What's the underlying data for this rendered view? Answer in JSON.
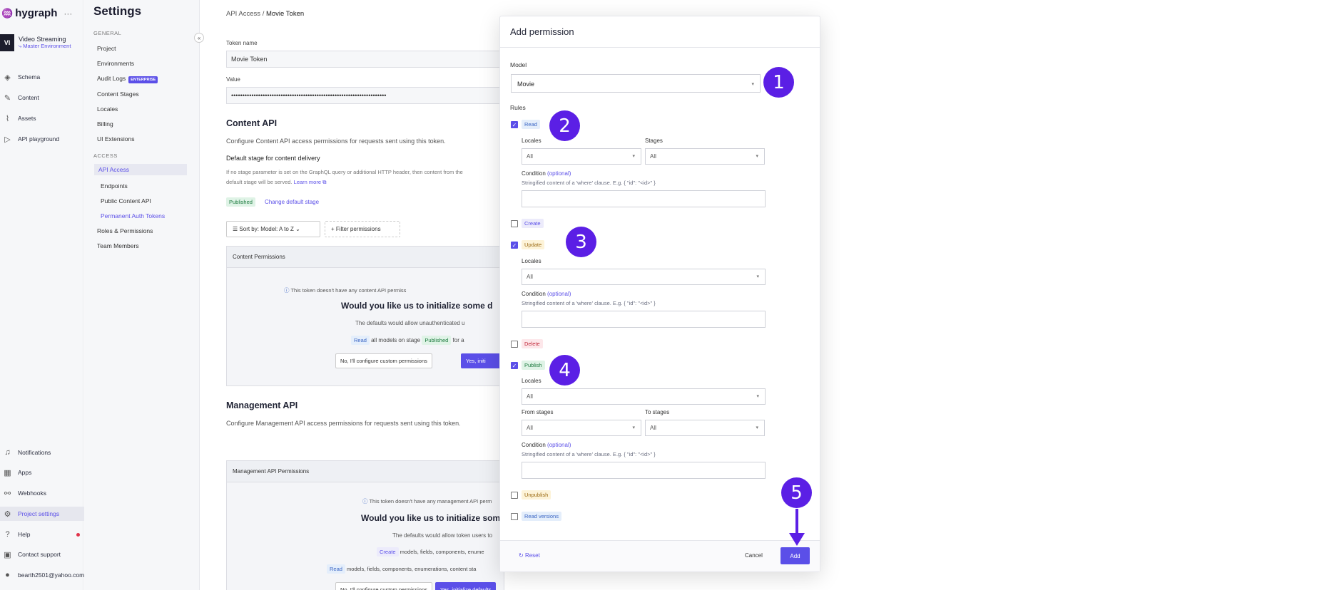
{
  "nav": {
    "logo": "hygraph",
    "logo_more": "···",
    "project_initials": "VI",
    "project_name": "Video Streaming",
    "environment": "Master Environment",
    "items": [
      {
        "label": "Schema",
        "icon": "schema-icon"
      },
      {
        "label": "Content",
        "icon": "content-icon"
      },
      {
        "label": "Assets",
        "icon": "assets-icon"
      },
      {
        "label": "API playground",
        "icon": "play-icon"
      }
    ],
    "bottom": [
      {
        "label": "Notifications",
        "icon": "bell-icon"
      },
      {
        "label": "Apps",
        "icon": "apps-icon"
      },
      {
        "label": "Webhooks",
        "icon": "webhooks-icon"
      },
      {
        "label": "Project settings",
        "icon": "gear-icon"
      },
      {
        "label": "Help",
        "icon": "help-icon"
      },
      {
        "label": "Contact support",
        "icon": "chat-icon"
      },
      {
        "label": "bearth2501@yahoo.com",
        "icon": "user-avatar"
      }
    ]
  },
  "settings": {
    "title": "Settings",
    "general_label": "GENERAL",
    "general": [
      "Project",
      "Environments",
      "Audit Logs",
      "Content Stages",
      "Locales",
      "Billing",
      "UI Extensions"
    ],
    "enterprise_badge": "ENTERPRISE",
    "access_label": "ACCESS",
    "access": [
      "API Access",
      "Endpoints",
      "Public Content API",
      "Permanent Auth Tokens",
      "Roles & Permissions",
      "Team Members"
    ]
  },
  "main": {
    "breadcrumb_1": "API Access",
    "breadcrumb_sep": "/",
    "breadcrumb_2": "Movie Token",
    "token_name_label": "Token name",
    "token_name_value": "Movie Token",
    "value_label": "Value",
    "value_masked": "•••••••••••••••••••••••••••••••••••••••••••••••••••••••••••••••••••••",
    "content_api_title": "Content API",
    "content_api_desc": "Configure Content API access permissions for requests sent using this token.",
    "default_stage_title": "Default stage for content delivery",
    "default_stage_desc_1": "If no stage parameter is set on the GraphQL query or additional HTTP header, then content from the",
    "default_stage_desc_2": "default stage will be served.",
    "learn_more": "Learn more",
    "published_tag": "Published",
    "change_stage": "Change default stage",
    "sort_label": "Sort by: Model: A to Z",
    "filter_label": "+ Filter permissions",
    "content_perm_header": "Content Permissions",
    "no_perm_info": "This token doesn't have any content API permiss",
    "init_question": "Would you like us to initialize some d",
    "defaults_desc": "The defaults would allow unauthenticated u",
    "read_tag": "Read",
    "all_models": "all models on stage",
    "published_tag2": "Published",
    "for_text": "for a",
    "no_custom": "No, I'll configure custom permissions",
    "yes_init": "Yes, initi",
    "mgmt_api_title": "Management API",
    "mgmt_api_desc": "Configure Management API access permissions for requests sent using this token.",
    "mgmt_perm_header": "Management API Permissions",
    "mgmt_no_perm": "This token doesn't have any management API perm",
    "mgmt_init_question": "Would you like us to initialize some",
    "mgmt_defaults_desc": "The defaults would allow token users to",
    "create_tag": "Create",
    "create_desc": "models, fields, components, enume",
    "read_tag2": "Read",
    "read_desc": "models, fields, components, enumerations, content sta",
    "mgmt_no_custom": "No, I'll configure custom permissions",
    "mgmt_yes": "Yes, initialize defaults"
  },
  "modal": {
    "title": "Add permission",
    "model_label": "Model",
    "model_value": "Movie",
    "rules_label": "Rules",
    "read": {
      "label": "Read",
      "checked": true,
      "locales_label": "Locales",
      "locales_value": "All",
      "stages_label": "Stages",
      "stages_value": "All",
      "condition_label": "Condition",
      "optional": "(optional)",
      "condition_hint": "Stringified content of a 'where' clause. E.g. { \"id\": \"<id>\" }"
    },
    "create": {
      "label": "Create",
      "checked": false
    },
    "update": {
      "label": "Update",
      "checked": true,
      "locales_label": "Locales",
      "locales_value": "All",
      "condition_label": "Condition",
      "optional": "(optional)",
      "condition_hint": "Stringified content of a 'where' clause. E.g. { \"id\": \"<id>\" }"
    },
    "delete": {
      "label": "Delete",
      "checked": false
    },
    "publish": {
      "label": "Publish",
      "checked": true,
      "locales_label": "Locales",
      "locales_value": "All",
      "from_label": "From stages",
      "from_value": "All",
      "to_label": "To stages",
      "to_value": "All",
      "condition_label": "Condition",
      "optional": "(optional)",
      "condition_hint": "Stringified content of a 'where' clause. E.g. { \"id\": \"<id>\" }"
    },
    "unpublish": {
      "label": "Unpublish",
      "checked": false
    },
    "read_versions": {
      "label": "Read versions",
      "checked": false
    },
    "reset": "Reset",
    "cancel": "Cancel",
    "add": "Add"
  },
  "annotations": [
    "1",
    "2",
    "3",
    "4",
    "5"
  ],
  "colors": {
    "accent": "#5b4fe8",
    "annotation": "#5b1fe5"
  }
}
